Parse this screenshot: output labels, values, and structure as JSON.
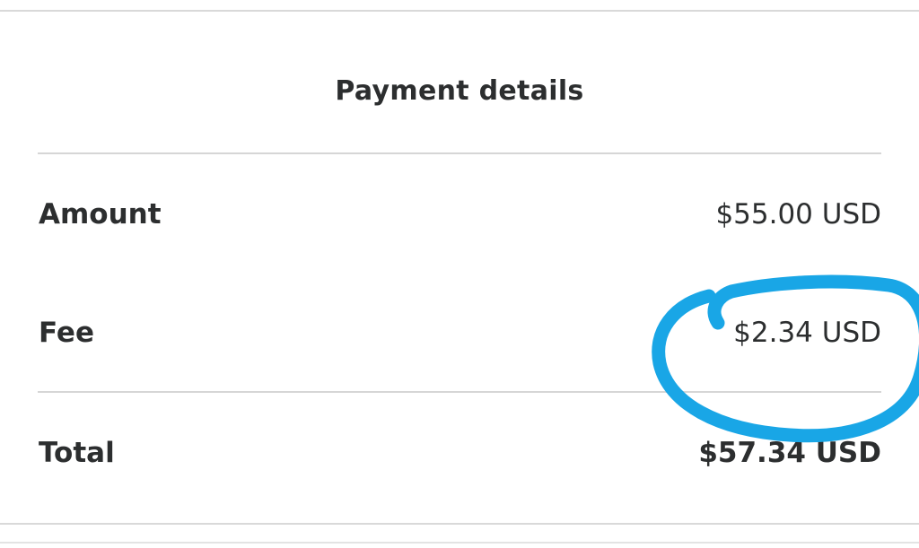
{
  "payment_details": {
    "title": "Payment details",
    "rows": [
      {
        "label": "Amount",
        "value": "$55.00 USD"
      },
      {
        "label": "Fee",
        "value": "$2.34 USD"
      },
      {
        "label": "Total",
        "value": "$57.34 USD"
      }
    ]
  },
  "annotation": {
    "circle_color": "#19a6e6",
    "target": "Fee"
  }
}
